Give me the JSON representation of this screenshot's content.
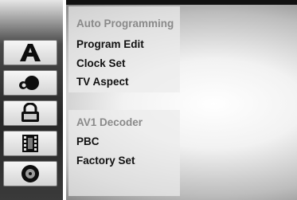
{
  "menu_top": {
    "items": [
      {
        "label": "Auto Programming",
        "state": "dimmed"
      },
      {
        "label": "Program Edit",
        "state": "normal"
      },
      {
        "label": "Clock Set",
        "state": "normal"
      },
      {
        "label": "TV Aspect",
        "state": "normal"
      }
    ]
  },
  "menu_bottom": {
    "items": [
      {
        "label": "AV1 Decoder",
        "state": "dimmed"
      },
      {
        "label": "PBC",
        "state": "normal"
      },
      {
        "label": "Factory Set",
        "state": "normal"
      }
    ]
  },
  "sidebar": {
    "icons": [
      "general-settings-icon",
      "audio-icon",
      "lock-icon",
      "movie-film-icon",
      "disc-icon"
    ]
  }
}
